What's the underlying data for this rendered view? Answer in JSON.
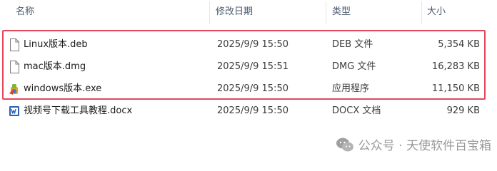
{
  "columns": {
    "name": "名称",
    "date": "修改日期",
    "type": "类型",
    "size": "大小"
  },
  "files": [
    {
      "name": "Linux版本.deb",
      "date": "2025/9/9 15:50",
      "type": "DEB 文件",
      "size": "5,354 KB",
      "icon": "blank-file-icon"
    },
    {
      "name": "mac版本.dmg",
      "date": "2025/9/9 15:51",
      "type": "DMG 文件",
      "size": "16,283 KB",
      "icon": "blank-file-icon"
    },
    {
      "name": "windows版本.exe",
      "date": "2025/9/9 15:50",
      "type": "应用程序",
      "size": "11,150 KB",
      "icon": "installer-app-icon"
    },
    {
      "name": "视频号下载工具教程.docx",
      "date": "2025/9/9 15:50",
      "type": "DOCX 文档",
      "size": "929 KB",
      "icon": "word-document-icon"
    }
  ],
  "watermark": {
    "text": "公众号 · 天使软件百宝箱",
    "icon": "wechat-icon"
  },
  "colors": {
    "highlight_border": "#e3485b",
    "word_blue": "#2b5fb8"
  }
}
